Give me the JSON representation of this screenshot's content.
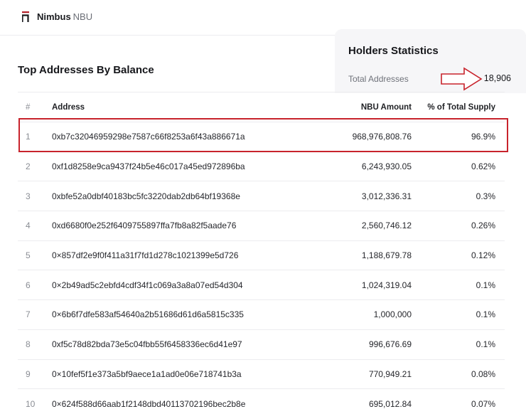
{
  "header": {
    "brand_name": "Nimbus",
    "brand_token": "NBU"
  },
  "stats": {
    "title": "Holders Statistics",
    "total_label": "Total Addresses",
    "total_value": "18,906"
  },
  "section": {
    "title": "Top Addresses By Balance"
  },
  "table": {
    "columns": {
      "rank": "#",
      "address": "Address",
      "amount": "NBU Amount",
      "pct": "% of Total Supply"
    },
    "rows": [
      {
        "rank": "1",
        "address": "0xb7c32046959298e7587c66f8253a6f43a886671a",
        "amount": "968,976,808.76",
        "pct": "96.9%"
      },
      {
        "rank": "2",
        "address": "0xf1d8258e9ca9437f24b5e46c017a45ed972896ba",
        "amount": "6,243,930.05",
        "pct": "0.62%"
      },
      {
        "rank": "3",
        "address": "0xbfe52a0dbf40183bc5fc3220dab2db64bf19368e",
        "amount": "3,012,336.31",
        "pct": "0.3%"
      },
      {
        "rank": "4",
        "address": "0xd6680f0e252f6409755897ffa7fb8a82f5aade76",
        "amount": "2,560,746.12",
        "pct": "0.26%"
      },
      {
        "rank": "5",
        "address": "0×857df2e9f0f411a31f7fd1d278c1021399e5d726",
        "amount": "1,188,679.78",
        "pct": "0.12%"
      },
      {
        "rank": "6",
        "address": "0×2b49ad5c2ebfd4cdf34f1c069a3a8a07ed54d304",
        "amount": "1,024,319.04",
        "pct": "0.1%"
      },
      {
        "rank": "7",
        "address": "0×6b6f7dfe583af54640a2b51686d61d6a5815c335",
        "amount": "1,000,000",
        "pct": "0.1%"
      },
      {
        "rank": "8",
        "address": "0xf5c78d82bda73e5c04fbb55f6458336ec6d41e97",
        "amount": "996,676.69",
        "pct": "0.1%"
      },
      {
        "rank": "9",
        "address": "0×10fef5f1e373a5bf9aece1a1ad0e06e718741b3a",
        "amount": "770,949.21",
        "pct": "0.08%"
      },
      {
        "rank": "10",
        "address": "0×624f588d66aab1f2148dbd40113702196bec2b8e",
        "amount": "695,012.84",
        "pct": "0.07%"
      }
    ]
  },
  "colors": {
    "annotation": "#c8232c",
    "brand": "#b3202a"
  }
}
